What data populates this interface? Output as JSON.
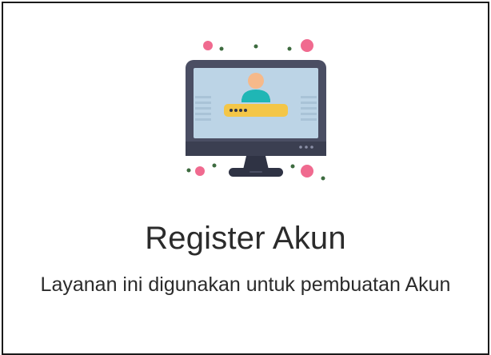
{
  "card": {
    "title": "Register Akun",
    "description": "Layanan ini digunakan untuk pembuatan Akun",
    "illustration_icon": "computer-login-icon"
  },
  "colors": {
    "border": "#1a1a1a",
    "text": "#2b2b2b",
    "monitor_body": "#4a4e63",
    "monitor_screen": "#bcd4e6",
    "password_field": "#f4c647",
    "user_shirt": "#1fb6b5",
    "user_face": "#f6b98a",
    "accent_dot": "#f06a8f",
    "small_dot": "#3d6b3f"
  }
}
